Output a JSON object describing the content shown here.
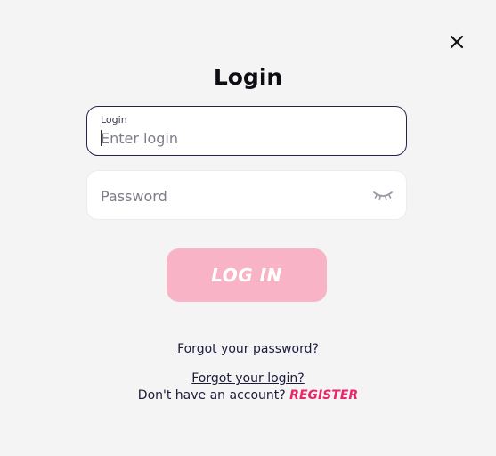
{
  "modal": {
    "title": "Login",
    "close_icon": "close-icon"
  },
  "login_field": {
    "label": "Login",
    "placeholder": "Enter login",
    "value": ""
  },
  "password_field": {
    "placeholder": "Password",
    "value": "",
    "toggle_icon": "eye-closed-icon"
  },
  "login_button": {
    "label": "LOG IN"
  },
  "links": {
    "forgot_password": "Forgot your password?",
    "forgot_login": "Forgot your login?",
    "no_account_text": "Don't have an account?",
    "register": "REGISTER"
  },
  "colors": {
    "background": "#f4f4f4",
    "button": "#f9b3c6",
    "register_accent": "#e8266a",
    "text_dark": "#1b1a3a"
  }
}
